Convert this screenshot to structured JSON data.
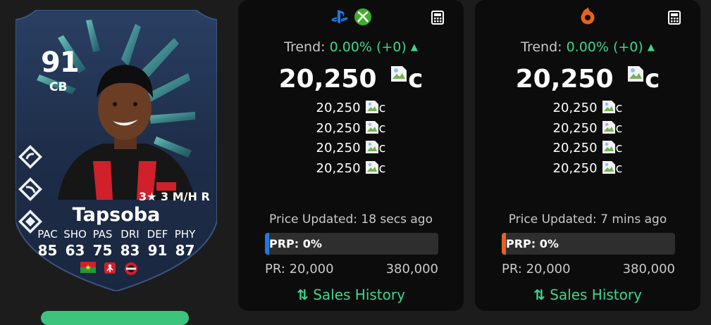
{
  "card": {
    "rating": "91",
    "position": "CB",
    "skills": "3★ 3 M/H R",
    "name": "Tapsoba",
    "stat_labels": [
      "PAC",
      "SHO",
      "PAS",
      "DRI",
      "DEF",
      "PHY"
    ],
    "stat_values": [
      "85",
      "63",
      "75",
      "83",
      "91",
      "87"
    ],
    "icons": [
      "country-flag-icon",
      "league-icon",
      "club-badge-icon"
    ]
  },
  "panels": [
    {
      "platform_icons": [
        "playstation-icon",
        "xbox-icon"
      ],
      "trend_label": "Trend:",
      "trend_value": "0.00% (+0)",
      "price": "20,250",
      "coin_alt": "c",
      "recent_prices": [
        "20,250",
        "20,250",
        "20,250",
        "20,250"
      ],
      "updated": "Price Updated: 18 secs ago",
      "prp": "PRP: 0%",
      "prp_value": 0,
      "pr_min": "PR: 20,000",
      "pr_max": "380,000",
      "sales_history": "Sales History",
      "accent": "#1f7ae0"
    },
    {
      "platform_icons": [
        "origin-icon"
      ],
      "trend_label": "Trend:",
      "trend_value": "0.00% (+0)",
      "price": "20,250",
      "coin_alt": "c",
      "recent_prices": [
        "20,250",
        "20,250",
        "20,250",
        "20,250"
      ],
      "updated": "Price Updated: 7 mins ago",
      "prp": "PRP: 0%",
      "prp_value": 0,
      "pr_min": "PR: 20,000",
      "pr_max": "380,000",
      "sales_history": "Sales History",
      "accent": "#e8621f"
    }
  ],
  "colors": {
    "trend_green": "#3dd68c",
    "panel_bg": "#0c0c0c",
    "card_accent": "#2fd1b0"
  }
}
